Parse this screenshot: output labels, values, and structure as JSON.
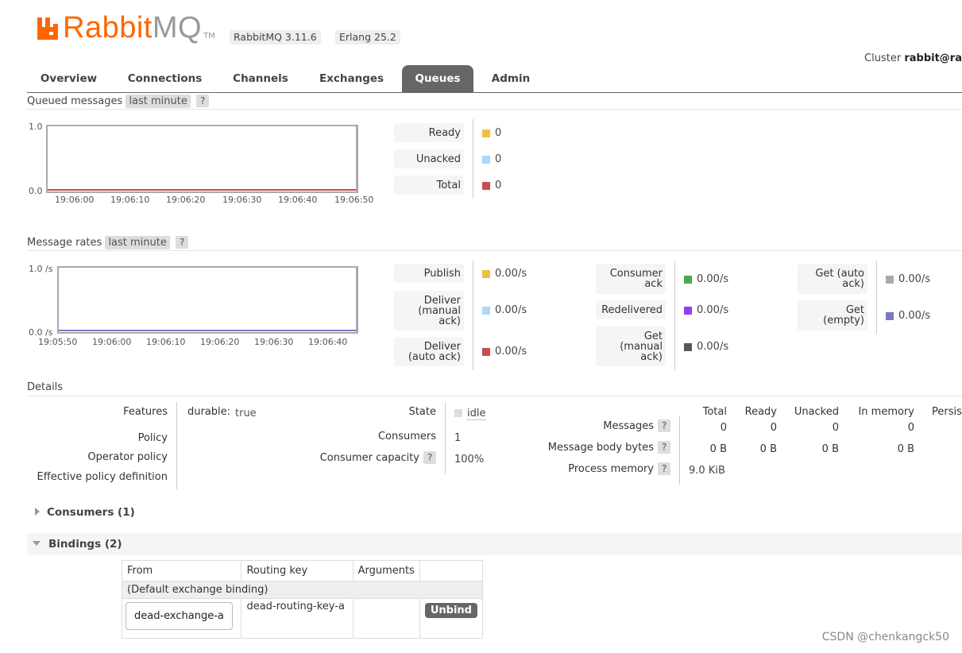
{
  "header": {
    "logo_rabbit": "Rabbit",
    "logo_mq": "MQ",
    "logo_tm": "TM",
    "rabbitmq_version": "RabbitMQ 3.11.6",
    "erlang_version": "Erlang 25.2",
    "cluster_label": "Cluster",
    "cluster_name": "rabbit@ra"
  },
  "tabs": [
    {
      "label": "Overview"
    },
    {
      "label": "Connections"
    },
    {
      "label": "Channels"
    },
    {
      "label": "Exchanges"
    },
    {
      "label": "Queues",
      "active": true
    },
    {
      "label": "Admin"
    }
  ],
  "queued_messages": {
    "title": "Queued messages",
    "range": "last minute",
    "help": "?",
    "chart_data": {
      "type": "line",
      "y_ticks": [
        "1.0",
        "0.0"
      ],
      "x_ticks": [
        "19:06:00",
        "19:06:10",
        "19:06:20",
        "19:06:30",
        "19:06:40",
        "19:06:50"
      ],
      "ylim": [
        0,
        1
      ],
      "series": [
        {
          "name": "Ready",
          "color": "#edc240",
          "values": [
            0,
            0,
            0,
            0,
            0,
            0
          ]
        },
        {
          "name": "Unacked",
          "color": "#afd8f8",
          "values": [
            0,
            0,
            0,
            0,
            0,
            0
          ]
        },
        {
          "name": "Total",
          "color": "#cb4b4b",
          "values": [
            0,
            0,
            0,
            0,
            0,
            0
          ]
        }
      ]
    },
    "legend": [
      {
        "label": "Ready",
        "value": "0",
        "color": "#edc240"
      },
      {
        "label": "Unacked",
        "value": "0",
        "color": "#afd8f8"
      },
      {
        "label": "Total",
        "value": "0",
        "color": "#cb4b4b"
      }
    ]
  },
  "message_rates": {
    "title": "Message rates",
    "range": "last minute",
    "help": "?",
    "chart_data": {
      "type": "line",
      "y_ticks": [
        "1.0 /s",
        "0.0 /s"
      ],
      "x_ticks": [
        "19:05:50",
        "19:06:00",
        "19:06:10",
        "19:06:20",
        "19:06:30",
        "19:06:40"
      ],
      "ylim": [
        0,
        1
      ],
      "series": [
        {
          "name": "Publish",
          "color": "#edc240",
          "values": [
            0,
            0,
            0,
            0,
            0,
            0
          ]
        },
        {
          "name": "Get (empty)",
          "color": "#7c79c3",
          "values": [
            0,
            0,
            0,
            0,
            0,
            0
          ]
        }
      ]
    },
    "col1": [
      {
        "label": "Publish",
        "value": "0.00/s",
        "color": "#edc240"
      },
      {
        "label": "Deliver (manual ack)",
        "value": "0.00/s",
        "color": "#afd8f8"
      },
      {
        "label": "Deliver (auto ack)",
        "value": "0.00/s",
        "color": "#cb4b4b"
      }
    ],
    "col2": [
      {
        "label": "Consumer ack",
        "value": "0.00/s",
        "color": "#4da74d"
      },
      {
        "label": "Redelivered",
        "value": "0.00/s",
        "color": "#9440ed"
      },
      {
        "label": "Get (manual ack)",
        "value": "0.00/s",
        "color": "#595959"
      }
    ],
    "col3": [
      {
        "label": "Get (auto ack)",
        "value": "0.00/s",
        "color": "#aaaaaa"
      },
      {
        "label": "Get (empty)",
        "value": "0.00/s",
        "color": "#7c79c3"
      }
    ]
  },
  "details": {
    "title": "Details",
    "features_label": "Features",
    "durable_key": "durable:",
    "durable_value": "true",
    "policy_label": "Policy",
    "operator_policy_label": "Operator policy",
    "effective_policy_label": "Effective policy definition",
    "state_label": "State",
    "state_value": "idle",
    "consumers_label": "Consumers",
    "consumers_value": "1",
    "capacity_label": "Consumer capacity",
    "capacity_value": "100%",
    "help": "?",
    "stats_headers": [
      "Total",
      "Ready",
      "Unacked",
      "In memory",
      "Persis"
    ],
    "messages_label": "Messages",
    "messages_values": [
      "0",
      "0",
      "0",
      "0"
    ],
    "body_bytes_label": "Message body bytes",
    "body_bytes_values": [
      "0 B",
      "0 B",
      "0 B",
      "0 B"
    ],
    "process_memory_label": "Process memory",
    "process_memory_value": "9.0 KiB"
  },
  "consumers_section": {
    "title": "Consumers (1)"
  },
  "bindings_section": {
    "title": "Bindings (2)",
    "headers": [
      "From",
      "Routing key",
      "Arguments"
    ],
    "default_binding": "(Default exchange binding)",
    "row": {
      "from": "dead-exchange-a",
      "routing_key": "dead-routing-key-a",
      "arguments": "",
      "action": "Unbind"
    }
  },
  "watermark": "CSDN @chenkangck50"
}
